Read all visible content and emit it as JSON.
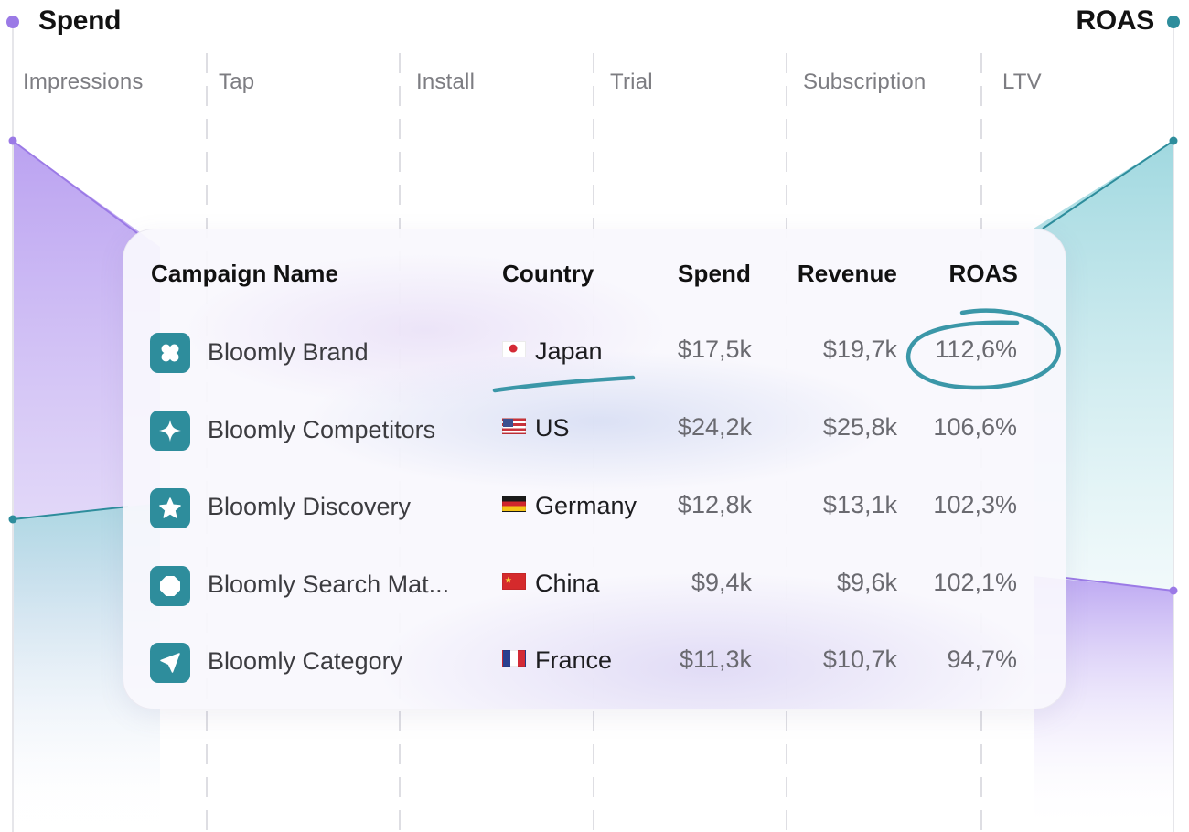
{
  "axes": {
    "left_title": "Spend",
    "right_title": "ROAS"
  },
  "stages": [
    "Impressions",
    "Tap",
    "Install",
    "Trial",
    "Subscription",
    "LTV"
  ],
  "table": {
    "headers": {
      "campaign": "Campaign Name",
      "country": "Country",
      "spend": "Spend",
      "revenue": "Revenue",
      "roas": "ROAS"
    },
    "rows": [
      {
        "icon": "clover-icon",
        "campaign": "Bloomly Brand",
        "flag": "japan-flag-icon",
        "country": "Japan",
        "spend": "$17,5k",
        "revenue": "$19,7k",
        "roas": "112,6%"
      },
      {
        "icon": "sparkle-icon",
        "campaign": "Bloomly Competitors",
        "flag": "us-flag-icon",
        "country": "US",
        "spend": "$24,2k",
        "revenue": "$25,8k",
        "roas": "106,6%"
      },
      {
        "icon": "star-icon",
        "campaign": "Bloomly Discovery",
        "flag": "germany-flag-icon",
        "country": "Germany",
        "spend": "$12,8k",
        "revenue": "$13,1k",
        "roas": "102,3%"
      },
      {
        "icon": "octagon-icon",
        "campaign": "Bloomly Search Mat...",
        "flag": "china-flag-icon",
        "country": "China",
        "spend": "$9,4k",
        "revenue": "$9,6k",
        "roas": "102,1%"
      },
      {
        "icon": "navigation-arrow-icon",
        "campaign": "Bloomly Category",
        "flag": "france-flag-icon",
        "country": "France",
        "spend": "$11,3k",
        "revenue": "$10,7k",
        "roas": "94,7%"
      }
    ]
  },
  "colors": {
    "spend_accent": "#9b7ae6",
    "roas_accent": "#2e8d9c",
    "spend_fill": "#c7b4f2",
    "roas_fill": "#a8dde3",
    "annotation": "#3b97a8",
    "icon_tile": "#2e8d9c"
  }
}
